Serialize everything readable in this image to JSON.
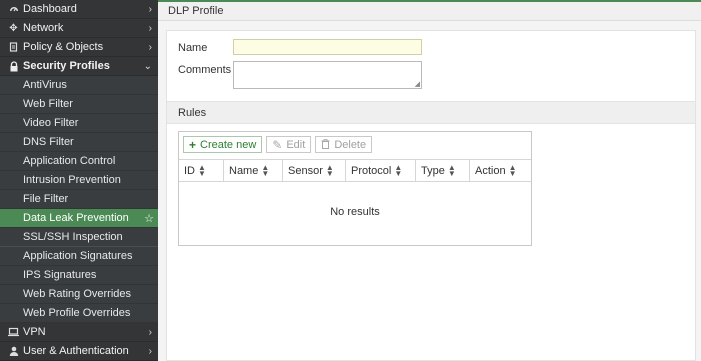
{
  "sidebar": {
    "top_items": [
      {
        "label": "Dashboard",
        "icon": "dashboard-icon"
      },
      {
        "label": "Network",
        "icon": "network-icon"
      },
      {
        "label": "Policy & Objects",
        "icon": "policy-icon"
      },
      {
        "label": "Security Profiles",
        "icon": "lock-icon"
      }
    ],
    "sub_items": [
      {
        "label": "AntiVirus"
      },
      {
        "label": "Web Filter"
      },
      {
        "label": "Video Filter"
      },
      {
        "label": "DNS Filter"
      },
      {
        "label": "Application Control"
      },
      {
        "label": "Intrusion Prevention"
      },
      {
        "label": "File Filter"
      },
      {
        "label": "Data Leak Prevention"
      },
      {
        "label": "SSL/SSH Inspection"
      },
      {
        "label": "Application Signatures"
      },
      {
        "label": "IPS Signatures"
      },
      {
        "label": "Web Rating Overrides"
      },
      {
        "label": "Web Profile Overrides"
      }
    ],
    "bottom_items": [
      {
        "label": "VPN",
        "icon": "vpn-icon"
      },
      {
        "label": "User & Authentication",
        "icon": "user-icon"
      }
    ],
    "active_color": "#4b8a54"
  },
  "page": {
    "title": "DLP Profile"
  },
  "form": {
    "name_label": "Name",
    "name_value": "",
    "comments_label": "Comments",
    "comments_value": ""
  },
  "rules": {
    "section_label": "Rules",
    "toolbar": {
      "create_label": "Create new",
      "edit_label": "Edit",
      "delete_label": "Delete"
    },
    "columns": [
      "ID",
      "Name",
      "Sensor",
      "Protocol",
      "Type",
      "Action"
    ],
    "empty_text": "No results"
  }
}
